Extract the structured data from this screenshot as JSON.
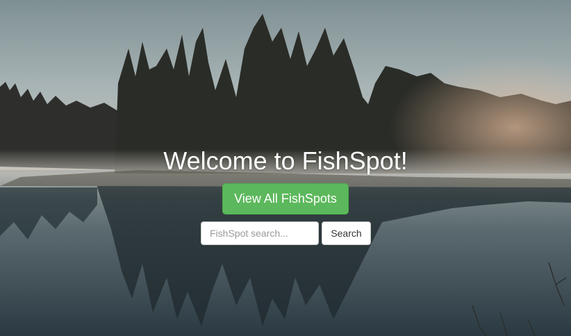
{
  "hero": {
    "title": "Welcome to FishSpot!",
    "cta_label": "View All FishSpots"
  },
  "search": {
    "placeholder": "FishSpot search...",
    "value": "",
    "button_label": "Search"
  },
  "colors": {
    "cta_background": "#5cb85c",
    "title_text": "#ffffff"
  }
}
